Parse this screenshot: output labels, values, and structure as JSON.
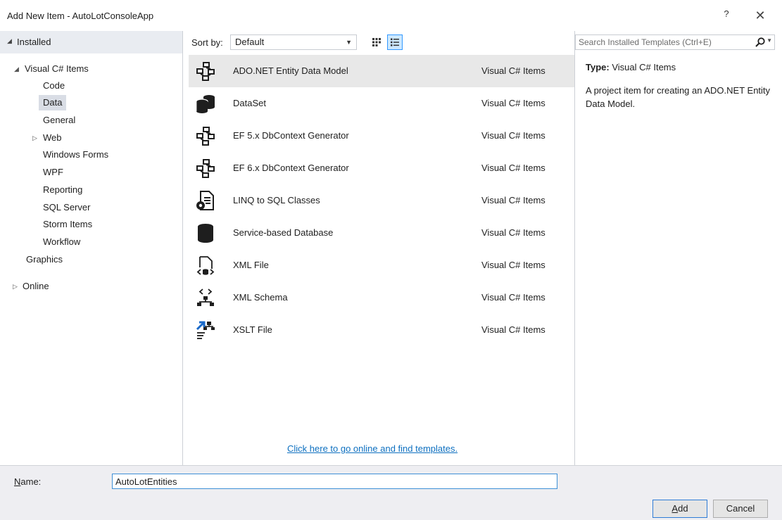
{
  "window": {
    "title": "Add New Item - AutoLotConsoleApp",
    "help": "?",
    "close": "✕"
  },
  "left": {
    "header_label": "Installed",
    "tree": [
      {
        "label": "Visual C# Items",
        "expanded": true
      },
      {
        "label": "Code"
      },
      {
        "label": "Data",
        "selected": true
      },
      {
        "label": "General"
      },
      {
        "label": "Web",
        "collapsed": true
      },
      {
        "label": "Windows Forms"
      },
      {
        "label": "WPF"
      },
      {
        "label": "Reporting"
      },
      {
        "label": "SQL Server"
      },
      {
        "label": "Storm Items"
      },
      {
        "label": "Workflow"
      },
      {
        "label": "Graphics"
      },
      {
        "label": "Online",
        "collapsed": true
      }
    ]
  },
  "toolbar": {
    "sort_label": "Sort by:",
    "sort_value": "Default",
    "view_medium_icons": "medium-icons-view",
    "view_small_icons": "small-icons-view"
  },
  "search": {
    "placeholder": "Search Installed Templates (Ctrl+E)"
  },
  "templates": [
    {
      "name": "ADO.NET Entity Data Model",
      "category": "Visual C# Items",
      "icon": "entity-model-icon",
      "selected": true
    },
    {
      "name": "DataSet",
      "category": "Visual C# Items",
      "icon": "dataset-icon"
    },
    {
      "name": "EF 5.x DbContext Generator",
      "category": "Visual C# Items",
      "icon": "ef-generator-icon"
    },
    {
      "name": "EF 6.x DbContext Generator",
      "category": "Visual C# Items",
      "icon": "ef-generator-icon"
    },
    {
      "name": "LINQ to SQL Classes",
      "category": "Visual C# Items",
      "icon": "linq-classes-icon"
    },
    {
      "name": "Service-based Database",
      "category": "Visual C# Items",
      "icon": "database-icon"
    },
    {
      "name": "XML File",
      "category": "Visual C# Items",
      "icon": "xml-file-icon"
    },
    {
      "name": "XML Schema",
      "category": "Visual C# Items",
      "icon": "xml-schema-icon"
    },
    {
      "name": "XSLT File",
      "category": "Visual C# Items",
      "icon": "xslt-file-icon"
    }
  ],
  "online_link": "Click here to go online and find templates.",
  "details": {
    "type_label": "Type:",
    "type_value": "Visual C# Items",
    "description": "A project item for creating an ADO.NET Entity Data Model."
  },
  "name_field": {
    "label_rest": "ame:",
    "label_accel": "N",
    "value": "AutoLotEntities"
  },
  "buttons": {
    "add_accel": "A",
    "add_rest": "dd",
    "cancel": "Cancel"
  },
  "colors": {
    "accent": "#3399ff",
    "link": "#0e70c0",
    "icon_dark": "#1e1e1e",
    "icon_blue": "#1b6ac9"
  }
}
